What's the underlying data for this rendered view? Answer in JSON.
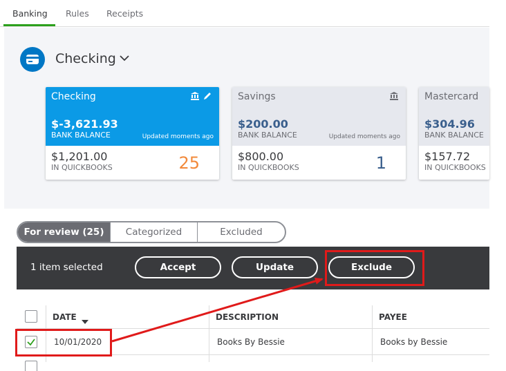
{
  "top_tabs": {
    "banking": "Banking",
    "rules": "Rules",
    "receipts": "Receipts"
  },
  "account_header": {
    "title": "Checking"
  },
  "cards": [
    {
      "name": "Checking",
      "bank_amount": "$-3,621.93",
      "bank_label": "BANK BALANCE",
      "updated": "Updated moments ago",
      "qb_amount": "$1,201.00",
      "qb_label": "IN QUICKBOOKS",
      "count": "25"
    },
    {
      "name": "Savings",
      "bank_amount": "$200.00",
      "bank_label": "BANK BALANCE",
      "updated": "Updated moments ago",
      "qb_amount": "$800.00",
      "qb_label": "IN QUICKBOOKS",
      "count": "1"
    },
    {
      "name": "Mastercard",
      "bank_amount": "$304.96",
      "bank_label": "BANK BALANCE",
      "qb_amount": "$157.72",
      "qb_label": "IN QUICKBOOKS"
    }
  ],
  "review_tabs": {
    "for_review": "For review (25)",
    "categorized": "Categorized",
    "excluded": "Excluded"
  },
  "action_bar": {
    "selected_text": "1 item selected",
    "accept": "Accept",
    "update": "Update",
    "exclude": "Exclude"
  },
  "table": {
    "headers": {
      "date": "DATE",
      "description": "DESCRIPTION",
      "payee": "PAYEE"
    },
    "rows": [
      {
        "date": "10/01/2020",
        "description": "Books By Bessie",
        "payee": "Books by Bessie",
        "checked": true
      }
    ]
  },
  "colors": {
    "accent_blue": "#0b9ae6",
    "brand_green": "#2ca01c",
    "annotation_red": "#e01a1a",
    "count_orange": "#f2893a"
  }
}
